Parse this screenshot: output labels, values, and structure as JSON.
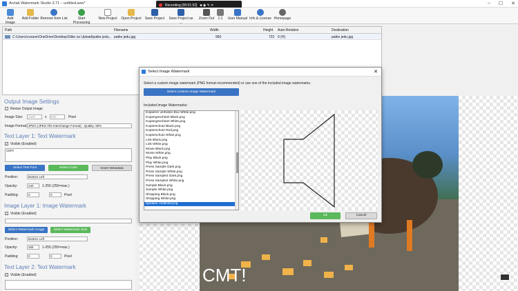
{
  "app": {
    "title": "Arclab Watermark Studio 3.71 – untitled.aws*",
    "recording": "Recording [00:01:52]"
  },
  "toolbar": {
    "add_image": "Add Image",
    "add_folder": "Add Folder",
    "remove": "Remove from List",
    "start": "Start Processing",
    "new_project": "New Project",
    "open_project": "Open Project",
    "save_project": "Save Project",
    "save_project_as": "Save Project as ...",
    "zoom_out": "Zoom Out",
    "one_to_one": "1:1",
    "user_manual": "User Manual",
    "info": "Info & License",
    "homepage": "Homepage"
  },
  "grid": {
    "headers": [
      "Path",
      "Filename",
      "Width",
      "Height",
      "Auto-Rotation",
      "Destination"
    ],
    "rows": [
      [
        "C:\\Users\\cvsane\\OneDrive\\Desktop\\Slike za Upload\\patke jedu...",
        "patke jedu.jpg",
        "960",
        "722",
        "0 (H)",
        "patke jedu.jpg"
      ]
    ]
  },
  "left": {
    "output_settings": "Output Image Settings",
    "resize": "Resize Output Image",
    "image_size": "Image Size:",
    "w": "1200",
    "x": "x",
    "h": "800",
    "pixel": "Pixel",
    "image_format": "Image Format:",
    "format_value": "JPEG (JPEG File Interchange Format) - Quality: 90%",
    "text_layer1": "Text Layer 1: Text Watermark",
    "visible": "Visible (Enabled)",
    "text_value": "CMT!",
    "select_font": "Select Text Font",
    "select_color": "Select Color",
    "insert_metadata": "Insert Metadata",
    "position": "Position:",
    "pos_value1": "Bottom Left",
    "opacity": "Opacity:",
    "opacity1": "240",
    "opacity_range": "1-255 (255=max.)",
    "padding": "Padding:",
    "pad1": "0",
    "pad2": "0",
    "image_layer1": "Image Layer 1: Image Watermark",
    "select_wm_image": "Select Watermark Image",
    "select_wm_size": "Select Watermark Size",
    "pos_value2": "Bottom Left",
    "opacity2": "255",
    "text_layer2": "Text Layer 2: Text Watermark"
  },
  "dialog": {
    "title": "Select Image Watermark",
    "desc": "Select a custom image watermark (PNG format recommended) or use one of the included image watermarks.",
    "custom_button": "Select Custom Image Watermark",
    "included": "Included Image Watermarks:",
    "items": [
      "Kopieren verboten Box White.png",
      "Kopiergeschützt Black.png",
      "Kopiergeschützt White.png",
      "Kopierschutz Black.png",
      "Kopierschutz Red.png",
      "Kopierschutz White.png",
      "Link Black.png",
      "Link White.png",
      "Movie Black.png",
      "Movie White.png",
      "Play Black.png",
      "Play White.png",
      "Press Sample Dark.png",
      "Press Sample White.png",
      "Press Sample2 Dark.png",
      "Press Sample2 White.png",
      "Sample Black.png",
      "Sample White.png",
      "Shopping Black.png",
      "Shopping White.png",
      "Speaker Outlined.png"
    ],
    "selected_index": 20,
    "ok": "Ok",
    "cancel": "Cancel"
  },
  "preview": {
    "watermark_text": "CMT!"
  },
  "colors": {
    "accent": "#3a74c4",
    "green": "#5bb85b",
    "section": "#5b7db6",
    "selection": "#1f6fd1"
  }
}
